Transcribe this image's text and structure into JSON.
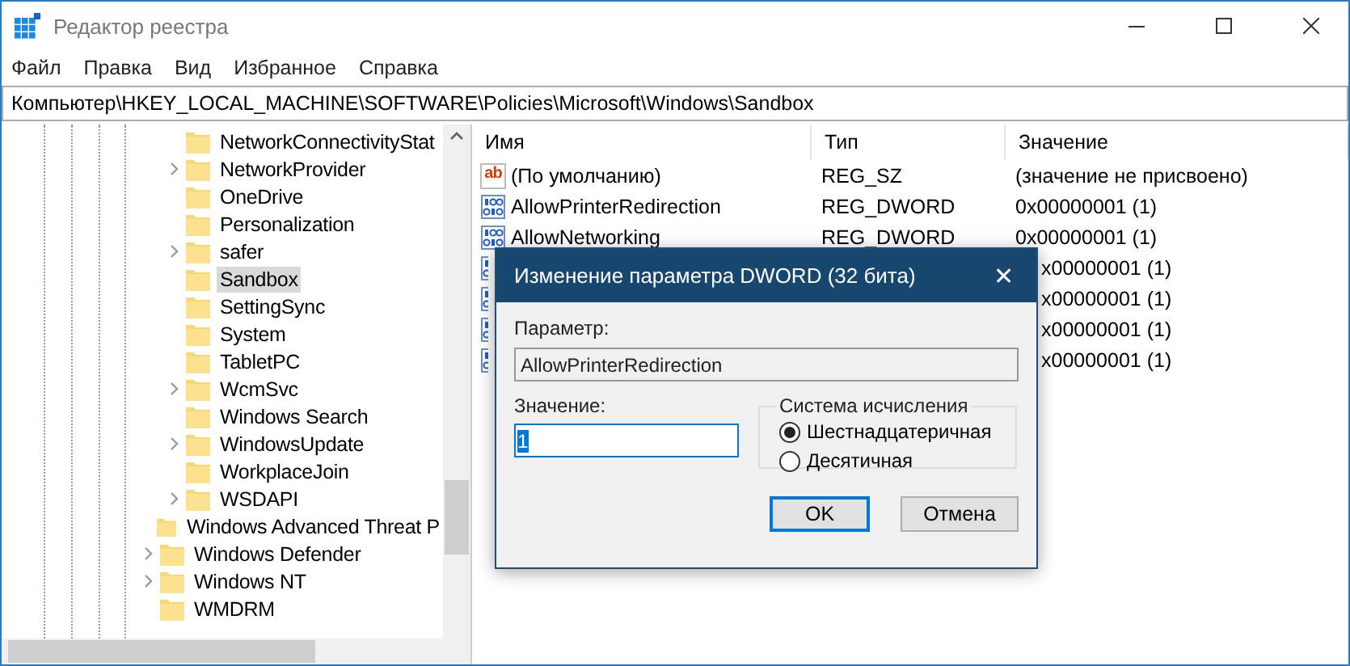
{
  "window": {
    "title": "Редактор реестра"
  },
  "menu": [
    "Файл",
    "Правка",
    "Вид",
    "Избранное",
    "Справка"
  ],
  "address": "Компьютер\\HKEY_LOCAL_MACHINE\\SOFTWARE\\Policies\\Microsoft\\Windows\\Sandbox",
  "tree": {
    "items": [
      {
        "children": [
          {
            "label": "NetworkConnectivityStat",
            "expandable": false,
            "selected": false
          },
          {
            "label": "NetworkProvider",
            "expandable": true,
            "selected": false
          },
          {
            "label": "OneDrive",
            "expandable": false,
            "selected": false
          },
          {
            "label": "Personalization",
            "expandable": false,
            "selected": false
          },
          {
            "label": "safer",
            "expandable": true,
            "selected": false
          },
          {
            "label": "Sandbox",
            "expandable": false,
            "selected": true
          },
          {
            "label": "SettingSync",
            "expandable": false,
            "selected": false
          },
          {
            "label": "System",
            "expandable": false,
            "selected": false
          },
          {
            "label": "TabletPC",
            "expandable": false,
            "selected": false
          },
          {
            "label": "WcmSvc",
            "expandable": true,
            "selected": false
          },
          {
            "label": "Windows Search",
            "expandable": false,
            "selected": false
          },
          {
            "label": "WindowsUpdate",
            "expandable": true,
            "selected": false
          },
          {
            "label": "WorkplaceJoin",
            "expandable": false,
            "selected": false
          },
          {
            "label": "WSDAPI",
            "expandable": true,
            "selected": false
          }
        ]
      },
      {
        "label": "Windows Advanced Threat P",
        "expandable": false,
        "selected": false
      },
      {
        "label": "Windows Defender",
        "expandable": true,
        "selected": false
      },
      {
        "label": "Windows NT",
        "expandable": true,
        "selected": false
      },
      {
        "label": "WMDRM",
        "expandable": false,
        "selected": false
      }
    ]
  },
  "values": {
    "columns": [
      "Имя",
      "Тип",
      "Значение"
    ],
    "rows": [
      {
        "kind": "string",
        "icon": "ab",
        "name": "(По умолчанию)",
        "type": "REG_SZ",
        "value": "(значение не присвоено)"
      },
      {
        "kind": "dword",
        "name": "AllowPrinterRedirection",
        "type": "REG_DWORD",
        "value": "0x00000001 (1)"
      },
      {
        "kind": "dword",
        "name": "AllowNetworking",
        "type": "REG_DWORD",
        "value": "0x00000001 (1)"
      },
      {
        "kind": "dword",
        "value": "x00000001 (1)"
      },
      {
        "kind": "dword",
        "value": "x00000001 (1)"
      },
      {
        "kind": "dword",
        "value": "x00000001 (1)"
      },
      {
        "kind": "dword",
        "value": "x00000001 (1)"
      }
    ]
  },
  "dialog": {
    "title": "Изменение параметра DWORD (32 бита)",
    "close": "✕",
    "name_label": "Параметр:",
    "name": "AllowPrinterRedirection",
    "value_label": "Значение:",
    "value": "1",
    "base_label": "Система исчисления",
    "bases": [
      {
        "label": "Шестнадцатеричная",
        "selected": true
      },
      {
        "label": "Десятичная",
        "selected": false
      }
    ],
    "buttons": [
      {
        "label": "OK",
        "default": true
      },
      {
        "label": "Отмена",
        "default": false
      }
    ]
  }
}
